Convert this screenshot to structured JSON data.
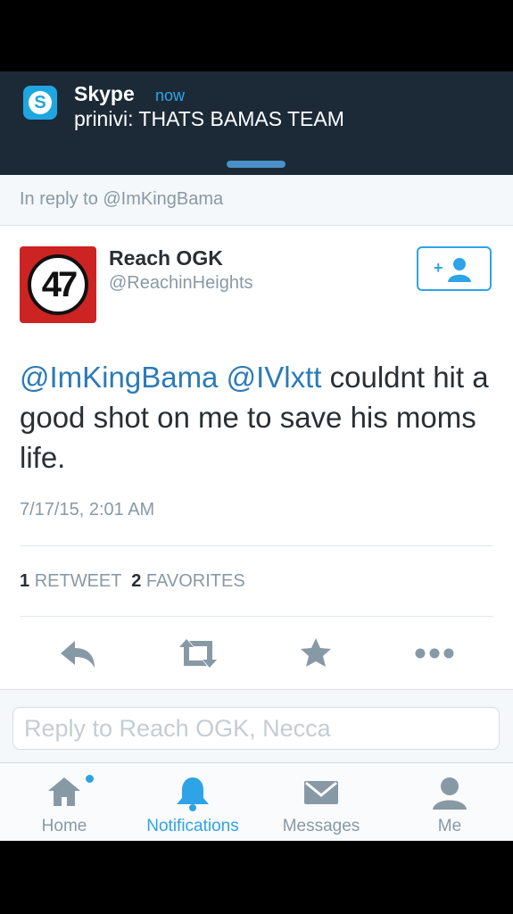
{
  "notification": {
    "app": "Skype",
    "time": "now",
    "message": "prinivi: THATS BAMAS TEAM",
    "logo_letter": "S"
  },
  "reply_context": "In reply to @ImKingBama",
  "tweet": {
    "avatar_text": "47",
    "author_name": "Reach OGK",
    "author_handle": "@ReachinHeights",
    "mention_1": "@ImKingBama",
    "mention_2": "@IVlxtt",
    "body": " couldnt hit a good shot on me to save his moms life.",
    "date": "7/17/15, 2:01 AM",
    "retweet_count": "1",
    "retweet_label": "RETWEET",
    "favorite_count": "2",
    "favorite_label": "FAVORITES"
  },
  "actions": [
    "reply-icon",
    "retweet-icon",
    "favorite-icon",
    "more-icon"
  ],
  "compose": {
    "placeholder": "Reply to Reach OGK, Necca"
  },
  "tabbar": {
    "home": "Home",
    "notifications": "Notifications",
    "messages": "Messages",
    "me": "Me"
  },
  "colors": {
    "accent": "#2ea3e6",
    "mention": "#2b7bb9",
    "muted": "#8899a6",
    "text": "#292f33",
    "notification_bg": "#1c2a38",
    "avatar_bg": "#cc2323"
  }
}
